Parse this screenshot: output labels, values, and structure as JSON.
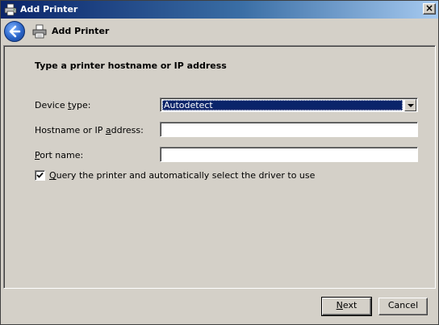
{
  "window": {
    "title": "Add Printer",
    "close_symbol": "×"
  },
  "header": {
    "title": "Add Printer",
    "back_icon": "back-arrow-icon",
    "printer_icon": "printer-icon"
  },
  "content": {
    "instruction": "Type a printer hostname or IP address",
    "device_type": {
      "label_pre": "Device ",
      "label_u": "t",
      "label_post": "ype:",
      "value": "Autodetect"
    },
    "hostname": {
      "label_pre": "Hostname or IP ",
      "label_u": "a",
      "label_post": "ddress:",
      "value": ""
    },
    "port": {
      "label_pre": "",
      "label_u": "P",
      "label_post": "ort name:",
      "value": ""
    },
    "query": {
      "checked": true,
      "label_pre": "",
      "label_u": "Q",
      "label_post": "uery the printer and automatically select the driver to use"
    }
  },
  "buttons": {
    "next": {
      "label_u": "N",
      "label_post": "ext"
    },
    "cancel": {
      "label": "Cancel"
    }
  },
  "colors": {
    "titlebar_start": "#0a246a",
    "titlebar_end": "#a6caf0",
    "face": "#d4d0c8",
    "selection": "#0a246a"
  }
}
